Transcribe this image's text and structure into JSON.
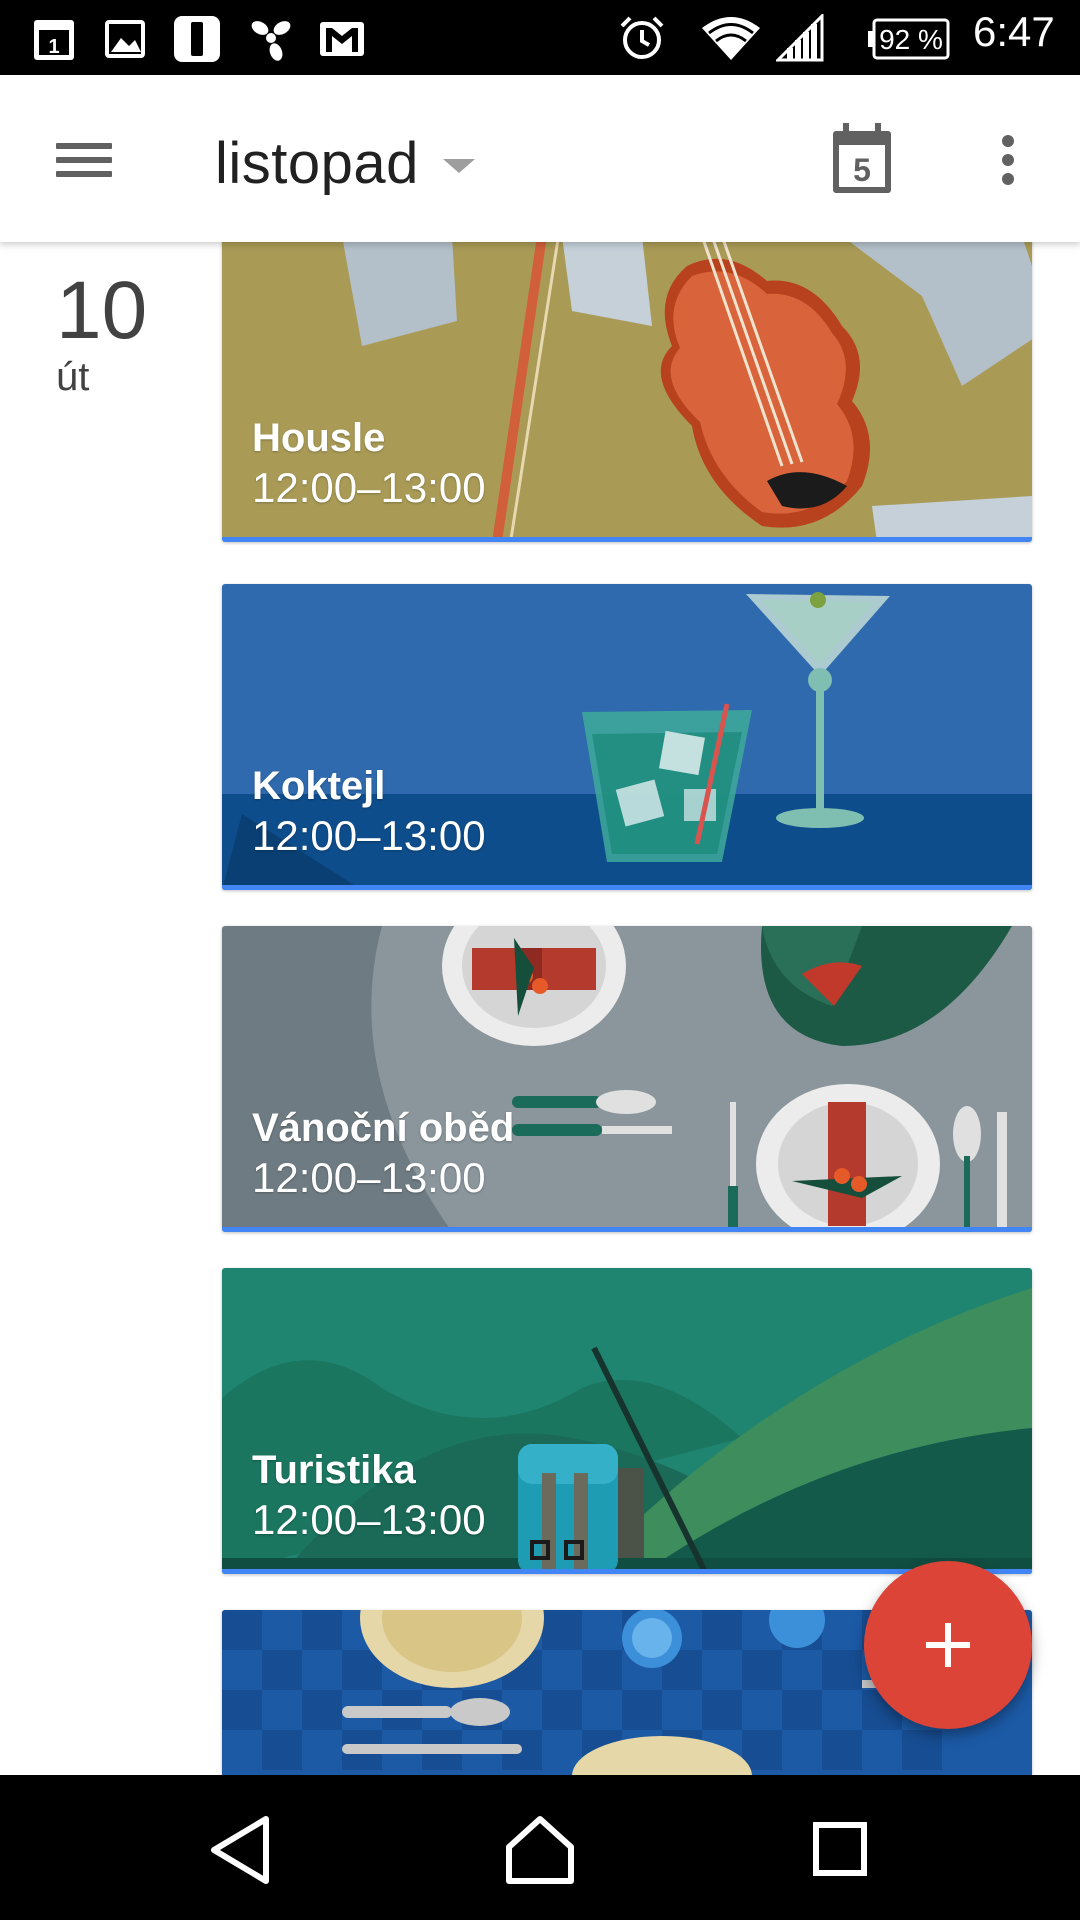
{
  "status_bar": {
    "icons": [
      "calendar-notification-icon",
      "image-notification-icon",
      "app-notification-icon",
      "fan-notification-icon",
      "gmail-notification-icon",
      "alarm-icon",
      "wifi-icon",
      "signal-icon",
      "battery-icon"
    ],
    "calendar_icon_day": "1",
    "battery": "92 %",
    "time": "6:47"
  },
  "app_bar": {
    "title": "listopad",
    "today_icon_day": "5",
    "icons": [
      "menu-icon",
      "dropdown-arrow-icon",
      "calendar-today-icon",
      "more-vert-icon"
    ]
  },
  "day": {
    "number": "10",
    "weekday": "út"
  },
  "events": [
    {
      "title": "Housle",
      "time": "12:00–13:00",
      "theme": "violin",
      "accent": "#4285f4"
    },
    {
      "title": "Koktejl",
      "time": "12:00–13:00",
      "theme": "cocktail",
      "accent": "#4285f4"
    },
    {
      "title": "Vánoční oběd",
      "time": "12:00–13:00",
      "theme": "christmas-dinner",
      "accent": "#4285f4"
    },
    {
      "title": "Turistika",
      "time": "12:00–13:00",
      "theme": "hiking",
      "accent": "#4285f4"
    },
    {
      "title": "",
      "time": "",
      "theme": "picnic"
    }
  ],
  "fab": {
    "icon": "add-icon",
    "color": "#db4437"
  },
  "nav_bar": {
    "icons": [
      "back-icon",
      "home-icon",
      "recents-icon"
    ]
  }
}
